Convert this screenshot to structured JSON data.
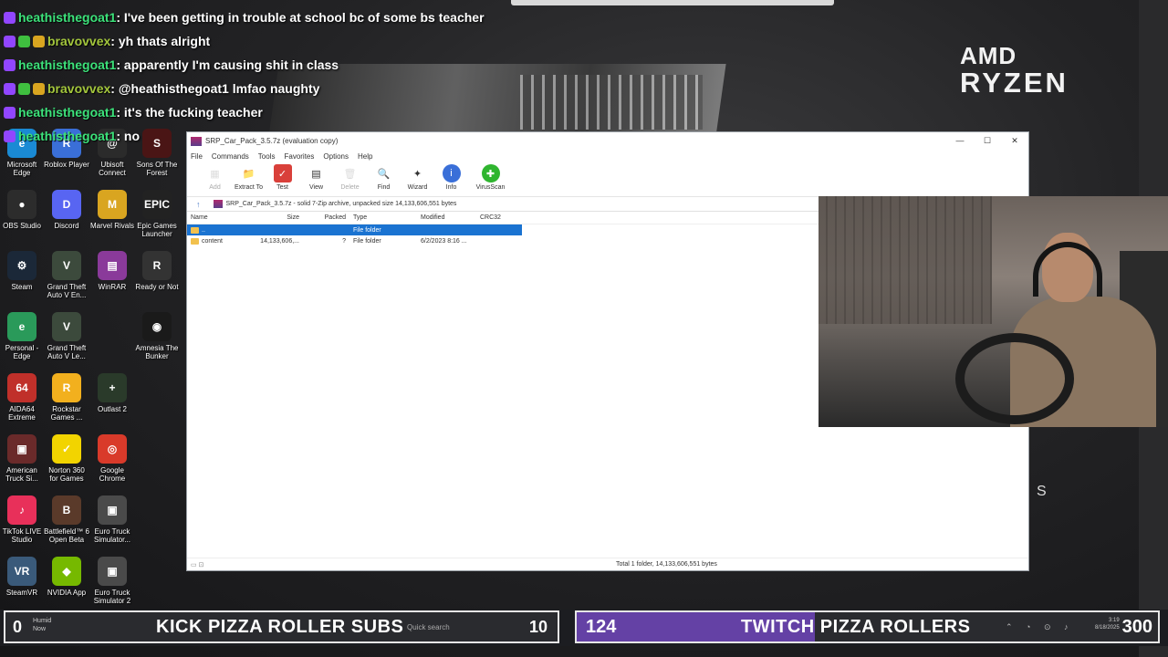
{
  "chat": [
    {
      "user": "heathisthegoat1",
      "message": ": I've been getting in trouble at school bc of some bs teacher",
      "badges": [
        "purple"
      ]
    },
    {
      "user": "bravovvex",
      "message": ": yh thats alright",
      "badges": [
        "purple",
        "green",
        "gold"
      ],
      "alt": true
    },
    {
      "user": "heathisthegoat1",
      "message": ": apparently I'm causing shit in class",
      "badges": [
        "purple"
      ]
    },
    {
      "user": "bravovvex",
      "message": ": @heathisthegoat1 lmfao naughty",
      "badges": [
        "purple",
        "green",
        "gold"
      ],
      "alt": true
    },
    {
      "user": "heathisthegoat1",
      "message": ": it's the fucking teacher",
      "badges": [
        "purple"
      ]
    },
    {
      "user": "heathisthegoat1",
      "message": ": no",
      "badges": [
        "purple"
      ]
    }
  ],
  "brand": {
    "top": "AMD",
    "bottom": "RYZEN"
  },
  "desktop_icons": [
    {
      "label": "Microsoft Edge",
      "icon": "edge-icon",
      "color": "#1a8ad4",
      "glyph": "e"
    },
    {
      "label": "Roblox Player",
      "icon": "roblox-icon",
      "color": "#3a6fd8",
      "glyph": "R"
    },
    {
      "label": "Ubisoft Connect",
      "icon": "ubisoft-icon",
      "color": "#2b2b2b",
      "glyph": "@"
    },
    {
      "label": "Sons Of The Forest",
      "icon": "sons-of-the-forest-icon",
      "color": "#4a1515",
      "glyph": "S"
    },
    {
      "label": "OBS Studio",
      "icon": "obs-icon",
      "color": "#2c2c2c",
      "glyph": "●"
    },
    {
      "label": "Discord",
      "icon": "discord-icon",
      "color": "#5865f2",
      "glyph": "D"
    },
    {
      "label": "Marvel Rivals",
      "icon": "marvel-rivals-icon",
      "color": "#d9a520",
      "glyph": "M"
    },
    {
      "label": "Epic Games Launcher",
      "icon": "epic-games-icon",
      "color": "#222",
      "glyph": "EPIC"
    },
    {
      "label": "Steam",
      "icon": "steam-icon",
      "color": "#1b2838",
      "glyph": "⚙"
    },
    {
      "label": "Grand Theft Auto V En...",
      "icon": "gta-v-icon",
      "color": "#3c4a3c",
      "glyph": "V"
    },
    {
      "label": "WinRAR",
      "icon": "winrar-icon",
      "color": "#8a3a9a",
      "glyph": "▤"
    },
    {
      "label": "Ready or Not",
      "icon": "ready-or-not-icon",
      "color": "#333",
      "glyph": "R"
    },
    {
      "label": "Personal - Edge",
      "icon": "edge-personal-icon",
      "color": "#2a9a5a",
      "glyph": "e"
    },
    {
      "label": "Grand Theft Auto V Le...",
      "icon": "gta-v-legacy-icon",
      "color": "#3c4a3c",
      "glyph": "V"
    },
    {
      "label": "Amnesia The Bunker",
      "icon": "amnesia-icon",
      "color": "#1a1a1a",
      "glyph": "◉"
    },
    {
      "label": "AIDA64 Extreme",
      "icon": "aida64-icon",
      "color": "#c0302a",
      "glyph": "64"
    },
    {
      "label": "Rockstar Games ...",
      "icon": "rockstar-icon",
      "color": "#f2b01e",
      "glyph": "R"
    },
    {
      "label": "Outlast 2",
      "icon": "outlast-icon",
      "color": "#2a3a2a",
      "glyph": "+"
    },
    {
      "label": "American Truck Si...",
      "icon": "ats-icon",
      "color": "#6a2a2a",
      "glyph": "▣"
    },
    {
      "label": "Norton 360 for Games",
      "icon": "norton-icon",
      "color": "#f2d400",
      "glyph": "✓"
    },
    {
      "label": "Google Chrome",
      "icon": "chrome-icon",
      "color": "#d93a2a",
      "glyph": "◎"
    },
    {
      "label": "TikTok LIVE Studio",
      "icon": "tiktok-icon",
      "color": "#e8305a",
      "glyph": "♪"
    },
    {
      "label": "Battlefield™ 6 Open Beta",
      "icon": "battlefield-icon",
      "color": "#5a3a2a",
      "glyph": "B"
    },
    {
      "label": "Euro Truck Simulator...",
      "icon": "ets-icon",
      "color": "#4a4a4a",
      "glyph": "▣"
    },
    {
      "label": "SteamVR",
      "icon": "steamvr-icon",
      "color": "#3a5a7a",
      "glyph": "VR"
    },
    {
      "label": "NVIDIA App",
      "icon": "nvidia-icon",
      "color": "#76b900",
      "glyph": "◆"
    },
    {
      "label": "Euro Truck Simulator 2",
      "icon": "ets2-icon",
      "color": "#4a4a4a",
      "glyph": "▣"
    }
  ],
  "winrar": {
    "title": "SRP_Car_Pack_3.5.7z (evaluation copy)",
    "menu": [
      "File",
      "Commands",
      "Tools",
      "Favorites",
      "Options",
      "Help"
    ],
    "toolbar": [
      {
        "label": "Add",
        "icon": "add-icon",
        "disabled": true,
        "glyph": "▦"
      },
      {
        "label": "Extract To",
        "icon": "extract-icon",
        "disabled": false,
        "glyph": "📁"
      },
      {
        "label": "Test",
        "icon": "test-icon",
        "disabled": false,
        "glyph": "✓"
      },
      {
        "label": "View",
        "icon": "view-icon",
        "disabled": false,
        "glyph": "▤"
      },
      {
        "label": "Delete",
        "icon": "delete-icon",
        "disabled": true,
        "glyph": "🗑"
      },
      {
        "label": "Find",
        "icon": "find-icon",
        "disabled": false,
        "glyph": "🔍"
      },
      {
        "label": "Wizard",
        "icon": "wizard-icon",
        "disabled": false,
        "glyph": "✦"
      },
      {
        "label": "Info",
        "icon": "info-icon",
        "disabled": false,
        "glyph": "i"
      },
      {
        "label": "VirusScan",
        "icon": "virusscan-icon",
        "disabled": false,
        "glyph": "✚"
      }
    ],
    "path": "SRP_Car_Pack_3.5.7z - solid 7-Zip archive, unpacked size 14,133,606,551 bytes",
    "columns": {
      "name": "Name",
      "size": "Size",
      "packed": "Packed",
      "type": "Type",
      "modified": "Modified",
      "crc": "CRC32"
    },
    "rows": [
      {
        "name": "..",
        "size": "",
        "packed": "",
        "type": "File folder",
        "modified": "",
        "crc": "",
        "selected": true
      },
      {
        "name": "content",
        "size": "14,133,606,...",
        "packed": "?",
        "type": "File folder",
        "modified": "6/2/2023 8:16 ...",
        "crc": "",
        "selected": false
      }
    ],
    "status": "Total 1 folder, 14,133,606,551 bytes"
  },
  "overlay": {
    "s_letter": "S",
    "kick": {
      "left_value": "0",
      "weather_top": "Humid",
      "weather_bottom": "Now",
      "title": "KICK PIZZA ROLLER SUBS",
      "search": "Quick search",
      "count": "10"
    },
    "twitch": {
      "count": "124",
      "title": "TWITCH PIZZA ROLLERS",
      "goal": "300",
      "progress": 0.41,
      "clock_time": "3:19",
      "clock_date": "8/18/2025"
    }
  },
  "colors": {
    "twitch_purple": "#6441a5",
    "selection": "#1a73d1",
    "chat_user": "#3ce27a"
  }
}
